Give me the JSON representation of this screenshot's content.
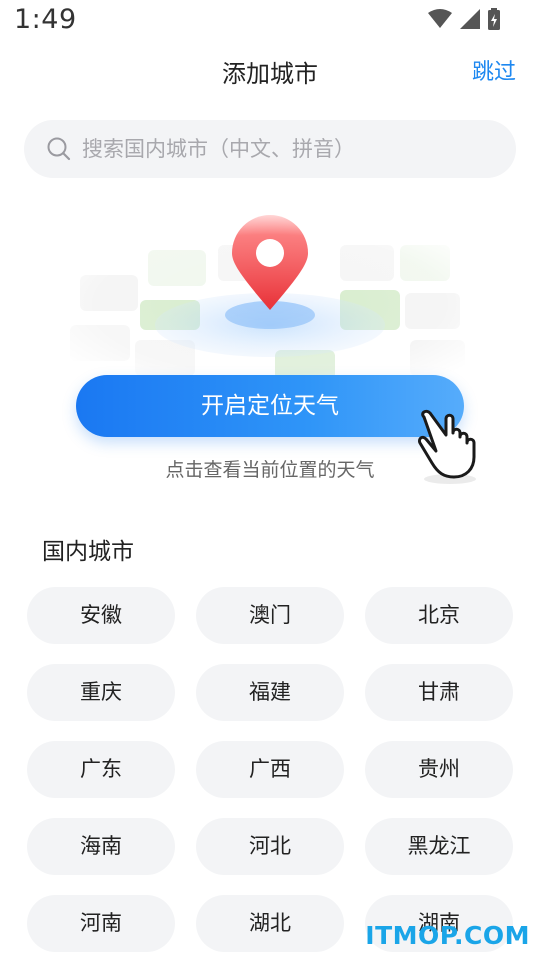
{
  "status_bar": {
    "time": "1:49",
    "icons": [
      "wifi-icon",
      "cellular-signal-icon",
      "battery-icon"
    ]
  },
  "header": {
    "title": "添加城市",
    "skip_label": "跳过"
  },
  "search": {
    "placeholder": "搜索国内城市（中文、拼音）",
    "value": ""
  },
  "locate": {
    "button_label": "开启定位天气",
    "hint": "点击查看当前位置的天气"
  },
  "domestic": {
    "section_title": "国内城市",
    "cities": [
      "安徽",
      "澳门",
      "北京",
      "重庆",
      "福建",
      "甘肃",
      "广东",
      "广西",
      "贵州",
      "海南",
      "河北",
      "黑龙江",
      "河南",
      "湖北",
      "湖南"
    ]
  },
  "watermark": "ITMOP.COM",
  "colors": {
    "accent": "#1e88f0",
    "button_gradient_start": "#1a78f2",
    "button_gradient_end": "#56acfb",
    "pin_red": "#f2454a",
    "chip_bg": "#f3f4f6",
    "watermark": "#1aa5e8"
  }
}
